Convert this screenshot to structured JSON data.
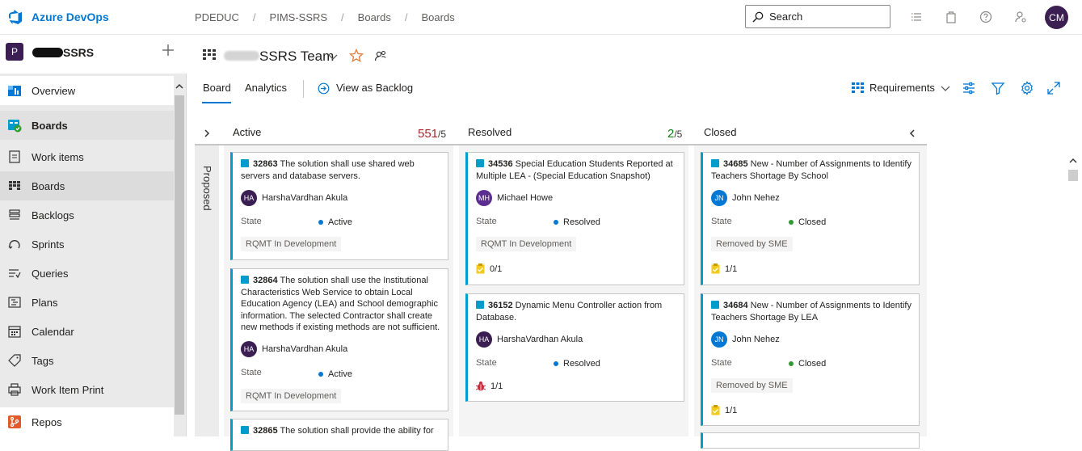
{
  "topbar": {
    "brand": "Azure DevOps",
    "breadcrumbs": [
      "PDEDUC",
      "PIMS-SSRS",
      "Boards",
      "Boards"
    ],
    "search_label": "Search",
    "user_initials": "CM",
    "colors": {
      "brand": "#0078d4",
      "avatar": "#3b1e52"
    }
  },
  "sidebar": {
    "project_initial": "P",
    "project_name": "SSRS",
    "items": [
      {
        "label": "Overview",
        "icon": "overview-icon"
      },
      {
        "label": "Boards",
        "icon": "boards-hub-icon"
      },
      {
        "label": "Work items",
        "icon": "work-items-icon"
      },
      {
        "label": "Boards",
        "icon": "boards-icon"
      },
      {
        "label": "Backlogs",
        "icon": "backlogs-icon"
      },
      {
        "label": "Sprints",
        "icon": "sprints-icon"
      },
      {
        "label": "Queries",
        "icon": "queries-icon"
      },
      {
        "label": "Plans",
        "icon": "plans-icon"
      },
      {
        "label": "Calendar",
        "icon": "calendar-icon"
      },
      {
        "label": "Tags",
        "icon": "tags-icon"
      },
      {
        "label": "Work Item Print",
        "icon": "print-icon"
      },
      {
        "label": "Repos",
        "icon": "repos-icon"
      }
    ]
  },
  "header": {
    "team_name": "SSRS Team",
    "tabs": [
      "Board",
      "Analytics"
    ],
    "view_as_backlog": "View as Backlog",
    "backlog_level": "Requirements"
  },
  "board": {
    "proposed_label": "Proposed",
    "columns": [
      {
        "name": "Active",
        "count": "551",
        "limit": "/5",
        "count_color": "#a4262c"
      },
      {
        "name": "Resolved",
        "count": "2",
        "limit": "/5",
        "count_color": "#107c10"
      },
      {
        "name": "Closed"
      }
    ],
    "state_label": "State",
    "cards": {
      "c1": {
        "id": "32863",
        "title": "The solution shall use shared web servers and database servers.",
        "person": "HarshaVardhan Akula",
        "initials": "HA",
        "state": "Active",
        "tag": "RQMT In Development"
      },
      "c2": {
        "id": "32864",
        "title": "The solution shall use the Institutional Characteristics Web Service to obtain Local Education Agency (LEA) and School demographic information. The selected Contractor shall create new methods if existing methods are not sufficient.",
        "person": "HarshaVardhan Akula",
        "initials": "HA",
        "state": "Active",
        "tag": "RQMT In Development"
      },
      "c3": {
        "id": "32865",
        "title": "The solution shall provide the ability for"
      },
      "c4": {
        "id": "34536",
        "title": "Special Education Students Reported at Multiple LEA - (Special Education Snapshot)",
        "person": "Michael Howe",
        "initials": "MH",
        "state": "Resolved",
        "tag": "RQMT In Development",
        "tasks": "0/1"
      },
      "c5": {
        "id": "36152",
        "title": "Dynamic Menu Controller action from Database.",
        "person": "HarshaVardhan Akula",
        "initials": "HA",
        "state": "Resolved",
        "bugs": "1/1"
      },
      "c6": {
        "id": "34685",
        "title": "New - Number of Assignments to Identify Teachers Shortage By School",
        "person": "John Nehez",
        "initials": "JN",
        "state": "Closed",
        "tag": "Removed by SME",
        "tasks": "1/1"
      },
      "c7": {
        "id": "34684",
        "title": "New - Number of Assignments to Identify Teachers Shortage By LEA",
        "person": "John Nehez",
        "initials": "JN",
        "state": "Closed",
        "tag": "Removed by SME",
        "tasks": "1/1"
      }
    },
    "state_colors": {
      "Active": "#0078d4",
      "Resolved": "#0078d4",
      "Closed": "#339933"
    }
  }
}
